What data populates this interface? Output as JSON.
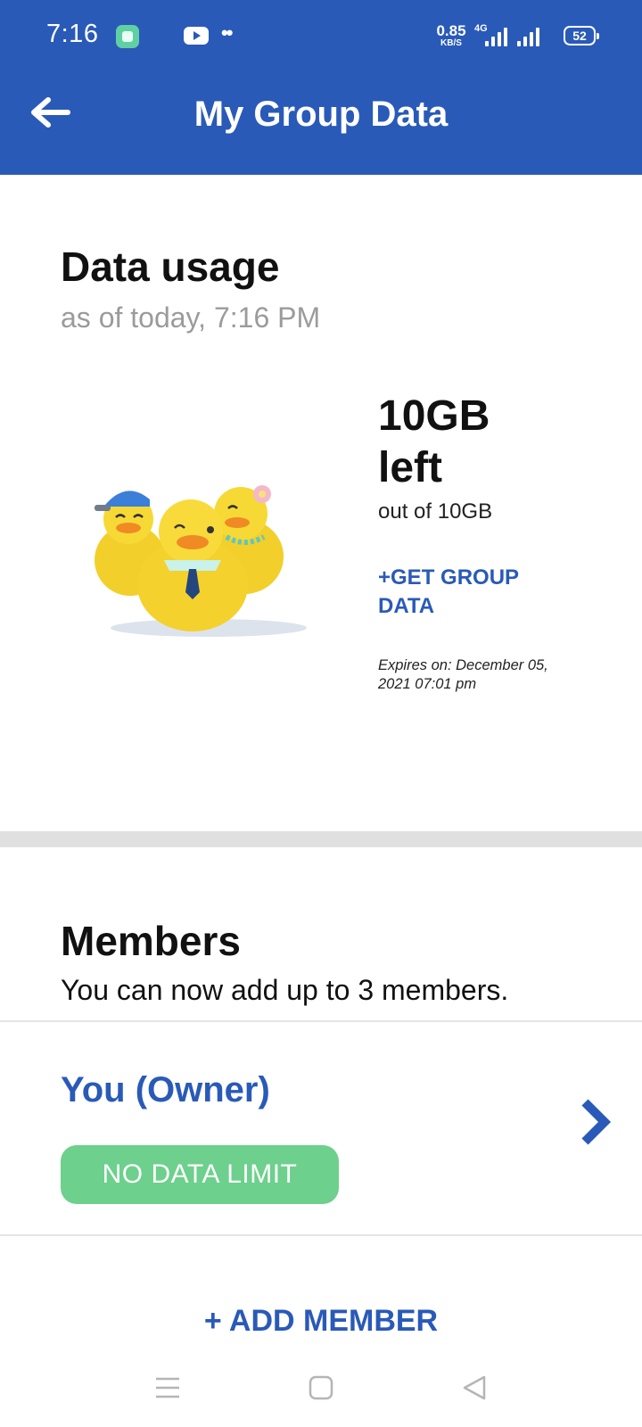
{
  "status_bar": {
    "time": "7:16",
    "net_speed_value": "0.85",
    "net_speed_unit": "KB/S",
    "network_type": "4G",
    "battery": "52",
    "icons": [
      "app-notification-icon",
      "youtube-icon",
      "more-dots-icon",
      "signal-4g-icon",
      "signal-icon",
      "battery-icon"
    ]
  },
  "app_bar": {
    "title": "My Group Data",
    "back_icon": "arrow-left-icon",
    "background_color": "#2a5ab8"
  },
  "data_usage": {
    "title": "Data usage",
    "as_of": "as of today, 7:16 PM",
    "amount_left": "10GB",
    "left_label": "left",
    "out_of": "out of 10GB",
    "get_data_label": "+GET GROUP DATA",
    "expires": "Expires on: December 05, 2021 07:01 pm",
    "illustration": "rubber-ducks-illustration"
  },
  "members": {
    "title": "Members",
    "subtitle": "You can now add up to 3 members.",
    "owner": {
      "name": "You (Owner)",
      "badge": "NO DATA LIMIT",
      "badge_color": "#6dd08c",
      "chevron_icon": "chevron-right-icon"
    },
    "add_member_label": "+ ADD MEMBER"
  },
  "nav_bar": {
    "icons": [
      "menu-icon",
      "home-square-icon",
      "back-triangle-icon"
    ]
  },
  "colors": {
    "accent": "#2a5ab8",
    "muted_text": "#9b9b9b",
    "divider": "#e0e0e0"
  }
}
